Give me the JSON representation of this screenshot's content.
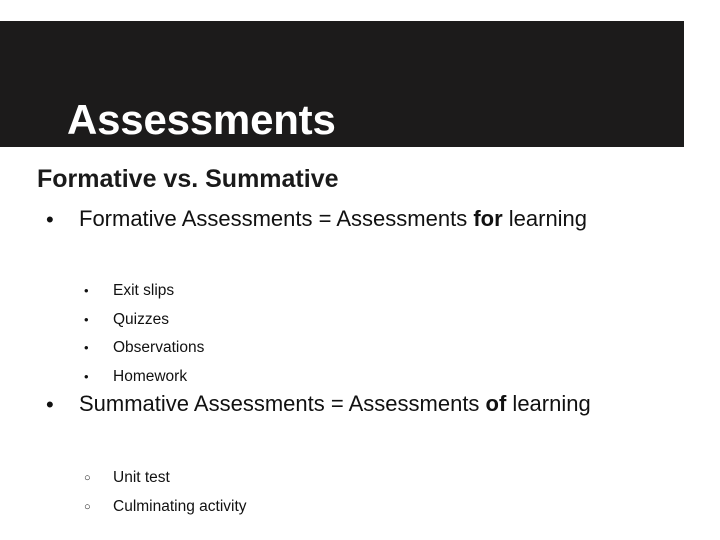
{
  "slide": {
    "title": "Assessments",
    "subtitle": "Formative vs. Summative",
    "banner_color": "#1c1b1b",
    "text_color": "#111111",
    "background_color": "#ffffff"
  },
  "content": {
    "bullet_marker": "•",
    "sub_marker_filled": "•",
    "sub_marker_hollow": "○",
    "blocks": [
      {
        "lead": "Formative Assessments = Assessments ",
        "emphasis": "for",
        "trail": " learning",
        "sub_items": [
          "Exit slips",
          "Quizzes",
          "Observations",
          "Homework"
        ]
      },
      {
        "lead": "Summative Assessments = Assessments ",
        "emphasis": "of",
        "trail": " learning",
        "sub_items": [
          "Unit test",
          "Culminating activity"
        ]
      }
    ]
  }
}
